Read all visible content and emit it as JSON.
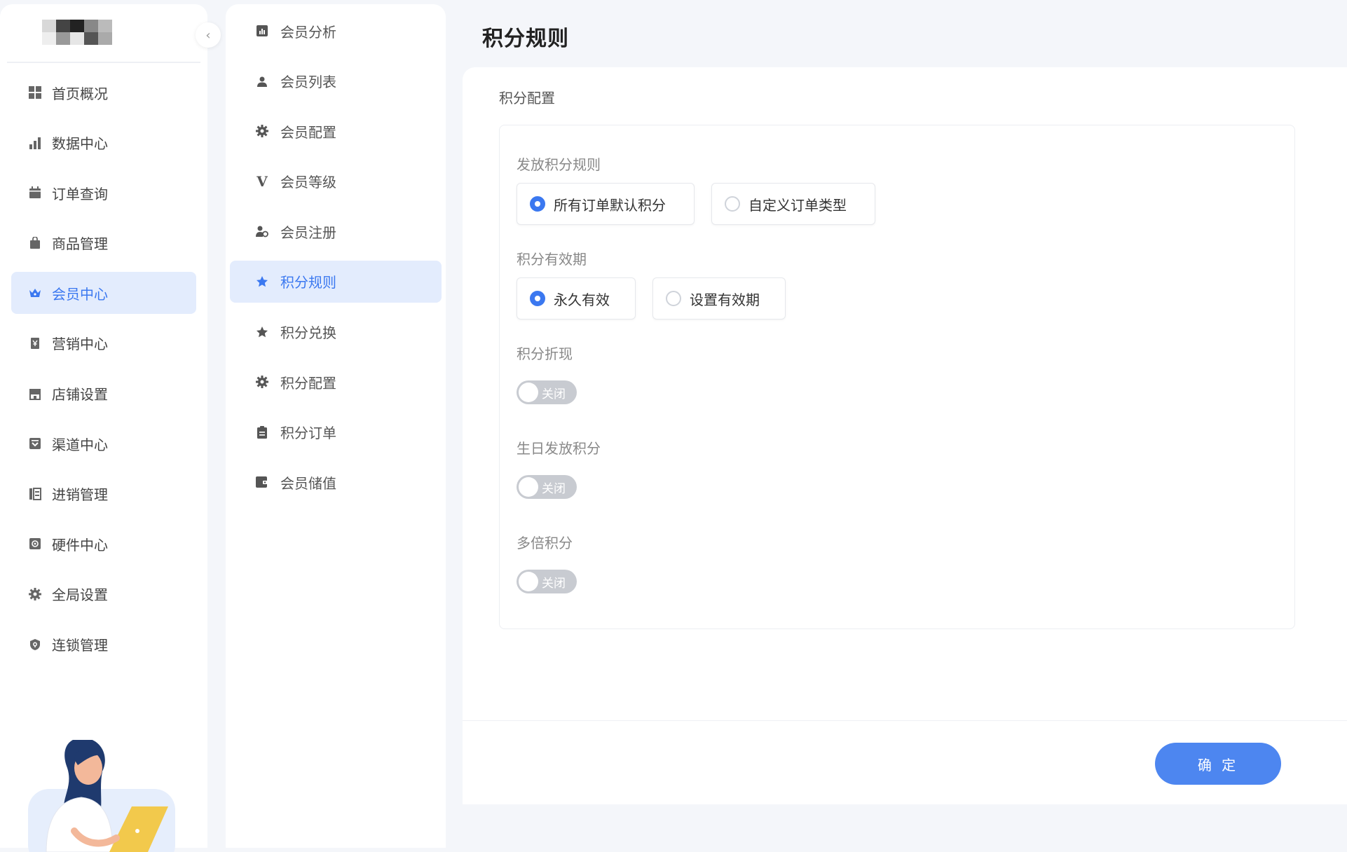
{
  "sidebar": {
    "items": [
      {
        "label": "首页概况",
        "icon": "grid-icon"
      },
      {
        "label": "数据中心",
        "icon": "bar-chart-icon"
      },
      {
        "label": "订单查询",
        "icon": "calendar-icon"
      },
      {
        "label": "商品管理",
        "icon": "shopping-bag-icon"
      },
      {
        "label": "会员中心",
        "icon": "crown-icon",
        "active": true
      },
      {
        "label": "营销中心",
        "icon": "marketing-icon"
      },
      {
        "label": "店铺设置",
        "icon": "store-icon"
      },
      {
        "label": "渠道中心",
        "icon": "channel-icon"
      },
      {
        "label": "进销管理",
        "icon": "inventory-icon"
      },
      {
        "label": "硬件中心",
        "icon": "hardware-icon"
      },
      {
        "label": "全局设置",
        "icon": "gear-icon"
      },
      {
        "label": "连锁管理",
        "icon": "shield-icon"
      }
    ]
  },
  "subnav": {
    "items": [
      {
        "label": "会员分析",
        "icon": "analysis-icon"
      },
      {
        "label": "会员列表",
        "icon": "user-icon"
      },
      {
        "label": "会员配置",
        "icon": "gear-icon"
      },
      {
        "label": "会员等级",
        "icon": "vip-v-icon"
      },
      {
        "label": "会员注册",
        "icon": "user-register-icon"
      },
      {
        "label": "积分规则",
        "icon": "star-icon",
        "active": true
      },
      {
        "label": "积分兑换",
        "icon": "star-icon"
      },
      {
        "label": "积分配置",
        "icon": "gear-icon"
      },
      {
        "label": "积分订单",
        "icon": "clipboard-icon"
      },
      {
        "label": "会员储值",
        "icon": "wallet-icon"
      }
    ]
  },
  "page": {
    "title": "积分规则",
    "section_title": "积分配置"
  },
  "form": {
    "issue_rule": {
      "label": "发放积分规则",
      "options": [
        "所有订单默认积分",
        "自定义订单类型"
      ],
      "selected": "所有订单默认积分"
    },
    "validity": {
      "label": "积分有效期",
      "options": [
        "永久有效",
        "设置有效期"
      ],
      "selected": "永久有效"
    },
    "cash_out": {
      "label": "积分折现",
      "state_label": "关闭",
      "enabled": false
    },
    "birthday_points": {
      "label": "生日发放积分",
      "state_label": "关闭",
      "enabled": false
    },
    "multiple_points": {
      "label": "多倍积分",
      "state_label": "关闭",
      "enabled": false
    }
  },
  "footer": {
    "confirm_label": "确 定"
  },
  "colors": {
    "accent": "#3b78f0",
    "button": "#4d86f0",
    "active_bg": "#e3ecfd",
    "toggle_off": "#c8cbd1"
  }
}
